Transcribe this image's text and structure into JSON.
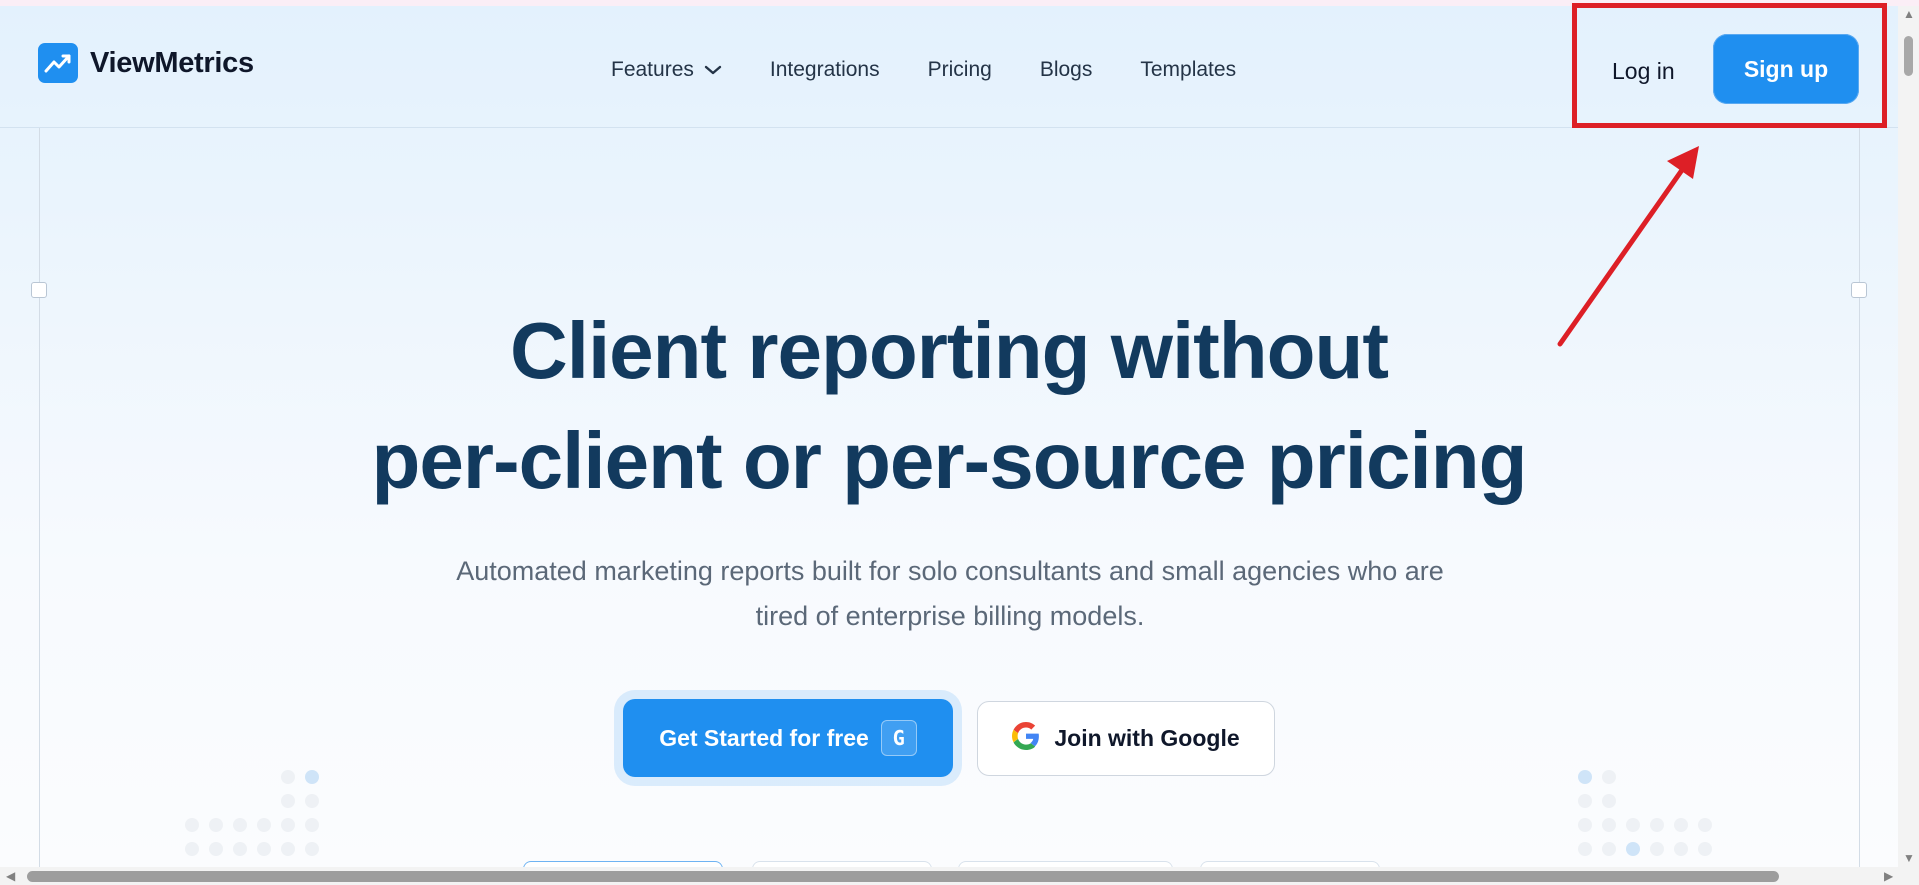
{
  "brand": {
    "name": "ViewMetrics",
    "logo_icon": "trend-chart-icon",
    "accent": "#1f8ff0"
  },
  "nav": {
    "items": [
      {
        "label": "Features",
        "has_dropdown": true
      },
      {
        "label": "Integrations"
      },
      {
        "label": "Pricing"
      },
      {
        "label": "Blogs"
      },
      {
        "label": "Templates"
      }
    ]
  },
  "auth": {
    "login_label": "Log in",
    "signup_label": "Sign up"
  },
  "hero": {
    "title_line1": "Client reporting without",
    "title_line2": "per-client or per-source pricing",
    "subtitle_line1": "Automated marketing reports built for solo consultants and small agencies who are",
    "subtitle_line2": "tired of enterprise billing models.",
    "primary_cta": "Get Started for free",
    "primary_cta_shortcut": "G",
    "google_cta": "Join with Google"
  },
  "annotation": {
    "color": "#dd1f26"
  }
}
